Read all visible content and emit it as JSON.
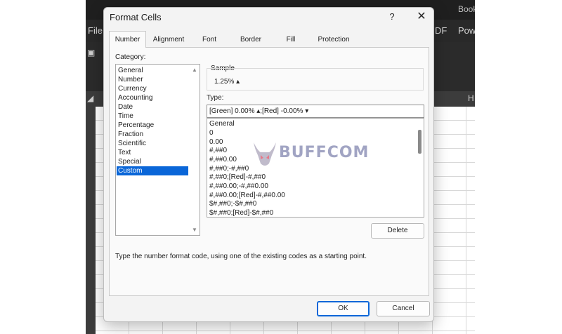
{
  "excel": {
    "title_fragment": "Book",
    "ribbon_left": "File",
    "ribbon_right": "DF",
    "ribbon_right2": "Pow",
    "col_letter": "H"
  },
  "dialog": {
    "title": "Format Cells",
    "help_glyph": "?",
    "close_glyph": "✕",
    "tabs": [
      "Number",
      "Alignment",
      "Font",
      "Border",
      "Fill",
      "Protection"
    ],
    "active_tab": "Number",
    "category_label": "Category:",
    "categories": [
      "General",
      "Number",
      "Currency",
      "Accounting",
      "Date",
      "Time",
      "Percentage",
      "Fraction",
      "Scientific",
      "Text",
      "Special",
      "Custom"
    ],
    "selected_category": "Custom",
    "sample_label": "Sample",
    "sample_value": "1.25% ▴",
    "type_label": "Type:",
    "type_value": "[Green] 0.00% ▴;[Red] -0.00% ▾",
    "format_codes": [
      "General",
      "0",
      "0.00",
      "#,##0",
      "#,##0.00",
      "#,##0;-#,##0",
      "#,##0;[Red]-#,##0",
      "#,##0.00;-#,##0.00",
      "#,##0.00;[Red]-#,##0.00",
      "$#,##0;-$#,##0",
      "$#,##0;[Red]-$#,##0"
    ],
    "delete_label": "Delete",
    "hint": "Type the number format code, using one of the existing codes as a starting point.",
    "ok_label": "OK",
    "cancel_label": "Cancel"
  },
  "watermark": {
    "text": "BUFFCOM",
    "color": "#7d82ad"
  },
  "colors": {
    "selection": "#0a66d8",
    "dialog_bg": "#f3f3f3",
    "excel_dark": "#2b2b2b"
  }
}
